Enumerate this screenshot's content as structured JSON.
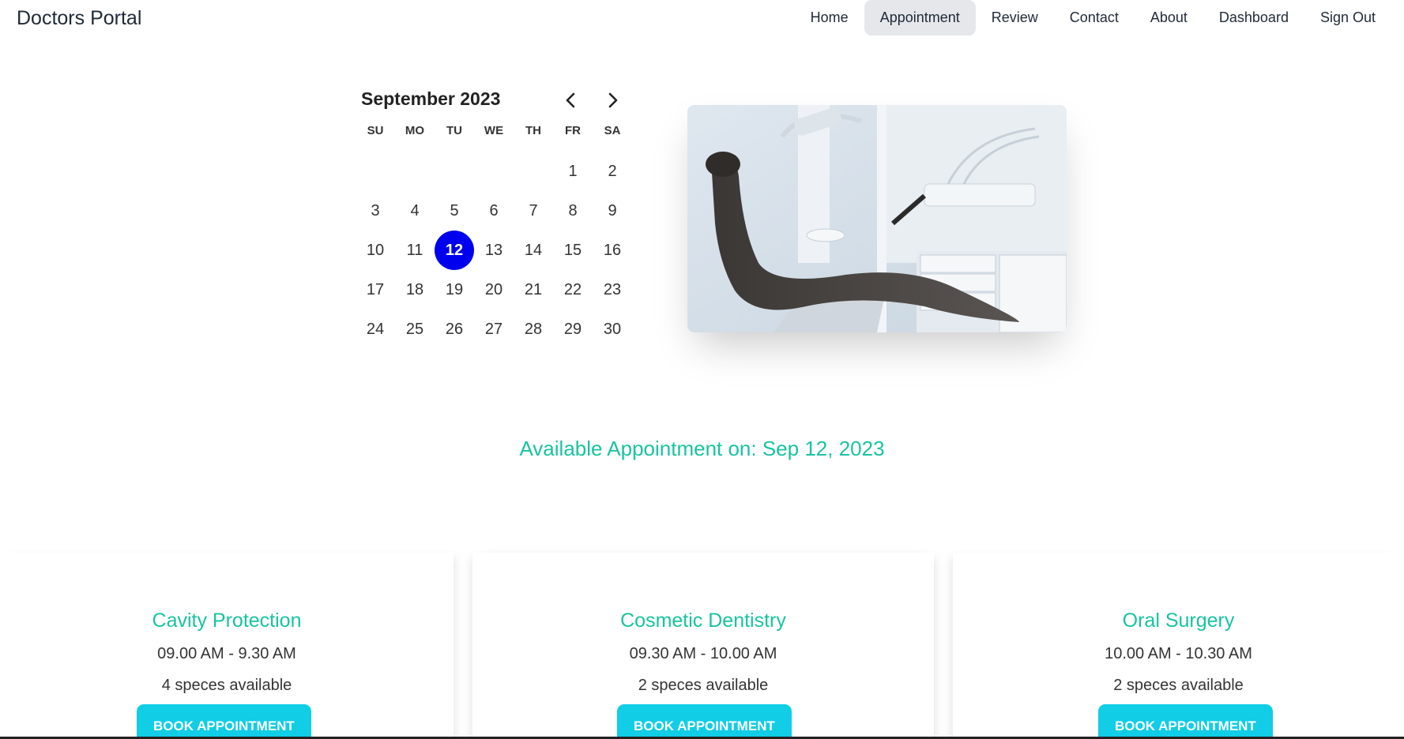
{
  "navbar": {
    "brand": "Doctors Portal",
    "items": [
      {
        "label": "Home",
        "active": false
      },
      {
        "label": "Appointment",
        "active": true
      },
      {
        "label": "Review",
        "active": false
      },
      {
        "label": "Contact",
        "active": false
      },
      {
        "label": "About",
        "active": false
      },
      {
        "label": "Dashboard",
        "active": false
      },
      {
        "label": "Sign Out",
        "active": false
      }
    ]
  },
  "calendar": {
    "title": "September 2023",
    "prev_icon": "chevron-left-icon",
    "next_icon": "chevron-right-icon",
    "weekdays": [
      "SU",
      "MO",
      "TU",
      "WE",
      "TH",
      "FR",
      "SA"
    ],
    "leading_blanks": 5,
    "days": [
      "1",
      "2",
      "3",
      "4",
      "5",
      "6",
      "7",
      "8",
      "9",
      "10",
      "11",
      "12",
      "13",
      "14",
      "15",
      "16",
      "17",
      "18",
      "19",
      "20",
      "21",
      "22",
      "23",
      "24",
      "25",
      "26",
      "27",
      "28",
      "29",
      "30"
    ],
    "selected": "12",
    "selected_color": "#0000ee"
  },
  "hero_image": {
    "icon": "dental-chair-photo"
  },
  "available": {
    "text": "Available Appointment on: Sep 12, 2023",
    "color": "#19c3a0"
  },
  "services": [
    {
      "title": "Cavity Protection",
      "time": "09.00 AM - 9.30 AM",
      "spaces": "4 speces available",
      "button": "BOOK APPOINTMENT"
    },
    {
      "title": "Cosmetic Dentistry",
      "time": "09.30 AM - 10.00 AM",
      "spaces": "2 speces available",
      "button": "BOOK APPOINTMENT"
    },
    {
      "title": "Oral Surgery",
      "time": "10.00 AM - 10.30 AM",
      "spaces": "2 speces available",
      "button": "BOOK APPOINTMENT"
    }
  ],
  "colors": {
    "accent": "#19c3a0",
    "button": "#11cde6",
    "nav_active_bg": "#e5e7eb"
  }
}
